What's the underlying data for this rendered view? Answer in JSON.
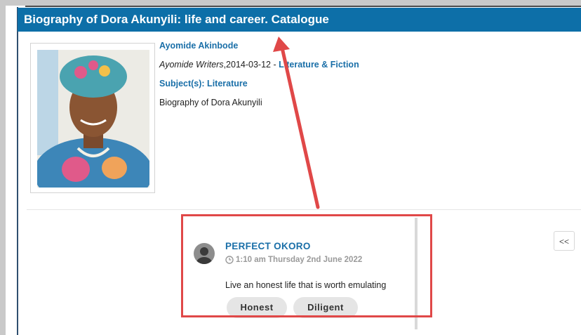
{
  "header": {
    "title": "Biography of Dora Akunyili: life and career. Catalogue"
  },
  "book": {
    "author": "Ayomide Akinbode",
    "publisher": "Ayomide Writers",
    "date": ",2014-03-12 - ",
    "category": "Literature & Fiction",
    "subjects": "Subject(s): Literature",
    "title": "Biography of Dora Akunyili"
  },
  "comment": {
    "author": "PERFECT OKORO",
    "time": "1:10 am Thursday 2nd June 2022",
    "text": "Live an honest life that is worth emulating",
    "tags": [
      "Honest",
      "Diligent"
    ]
  },
  "controls": {
    "collapse_label": "<<"
  },
  "icons": {
    "clock": "clock-icon",
    "avatar": "user-avatar-icon",
    "collapse": "double-chevron-left-icon"
  },
  "colors": {
    "header_bg": "#0d6fa8",
    "link": "#1a6fa8",
    "annotation": "#e04848"
  }
}
